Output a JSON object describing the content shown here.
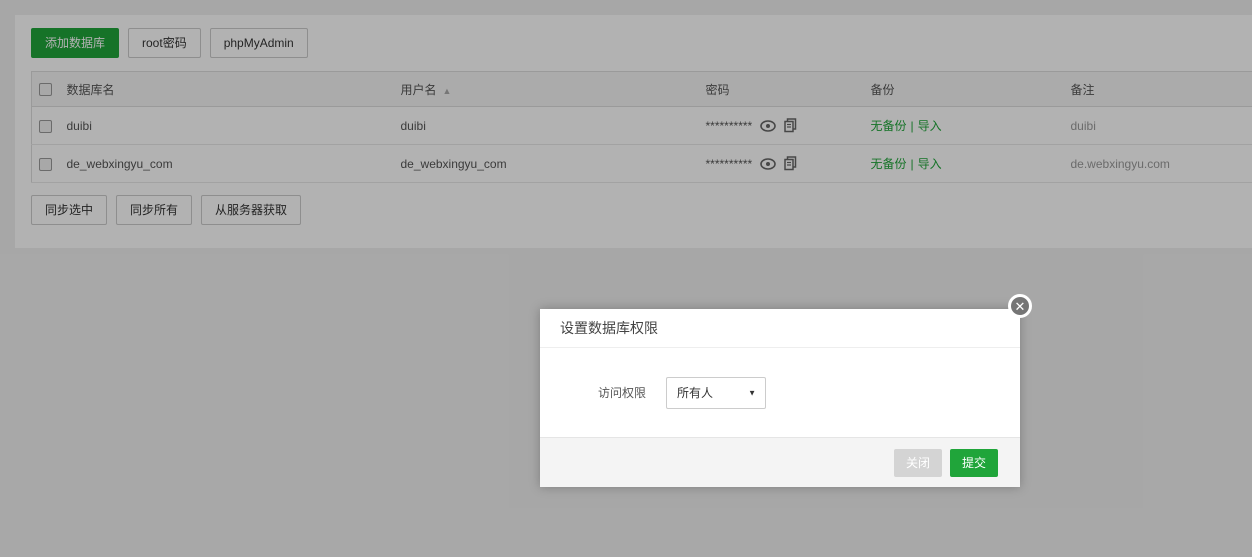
{
  "toolbar": {
    "add_db": "添加数据库",
    "root_pwd": "root密码",
    "phpmyadmin": "phpMyAdmin"
  },
  "table": {
    "headers": {
      "name": "数据库名",
      "user": "用户名",
      "password": "密码",
      "backup": "备份",
      "note": "备注"
    },
    "rows": [
      {
        "name": "duibi",
        "user": "duibi",
        "password_mask": "**********",
        "backup_status": "无备份",
        "import_link": "导入",
        "note": "duibi"
      },
      {
        "name": "de_webxingyu_com",
        "user": "de_webxingyu_com",
        "password_mask": "**********",
        "backup_status": "无备份",
        "import_link": "导入",
        "note": "de.webxingyu.com"
      }
    ],
    "link_separator": "|"
  },
  "bottom_bar": {
    "sync_selected": "同步选中",
    "sync_all": "同步所有",
    "fetch_from_server": "从服务器获取"
  },
  "modal": {
    "title": "设置数据库权限",
    "field_label": "访问权限",
    "select_value": "所有人",
    "close_button": "关闭",
    "submit_button": "提交"
  },
  "icons": {
    "sort_asc": "▲",
    "caret_down": "▼",
    "close_x": "✕"
  },
  "colors": {
    "accent_green": "#20a53a",
    "panel_bg": "#ffffff",
    "page_bg": "#f0f0f0"
  }
}
